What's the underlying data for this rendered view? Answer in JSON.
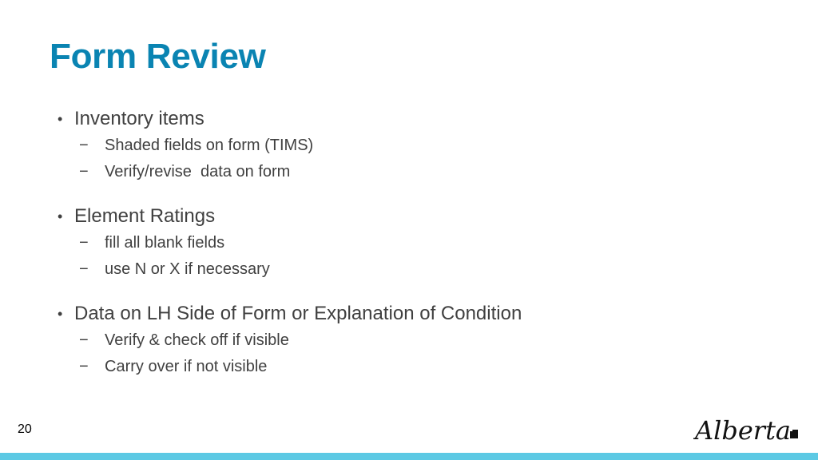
{
  "slide": {
    "title": "Form Review",
    "page_number": "20",
    "bullets": [
      {
        "text": "Inventory items",
        "subitems": [
          "Shaded fields on form (TIMS)",
          "Verify/revise  data on form"
        ]
      },
      {
        "text": "Element Ratings",
        "subitems": [
          "fill all blank fields",
          "use N or X if necessary"
        ]
      },
      {
        "text": "Data on LH Side of Form or Explanation of Condition",
        "subitems": [
          "Verify & check off if visible",
          "Carry over if not visible"
        ]
      }
    ],
    "bullet_glyph": "•",
    "sub_glyph": "−",
    "logo_text": "Alberta",
    "colors": {
      "title": "#0a84b2",
      "body_text": "#404040",
      "bottom_bar": "#5cc9e4"
    }
  }
}
